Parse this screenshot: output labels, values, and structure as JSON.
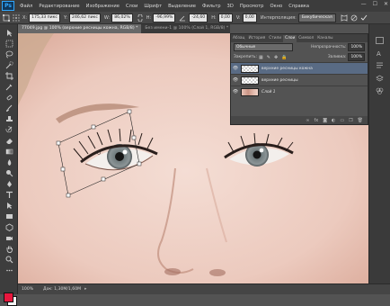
{
  "app": {
    "logo": "Ps",
    "menu": [
      "Файл",
      "Редактирование",
      "Изображение",
      "Слои",
      "Шрифт",
      "Выделение",
      "Фильтр",
      "3D",
      "Просмотр",
      "Окно",
      "Справка"
    ],
    "window_controls": [
      "—",
      "☐",
      "✕"
    ]
  },
  "options_bar": {
    "x_label": "X:",
    "x_value": "175,33 пикс",
    "y_label": "Y:",
    "y_value": "246,62 пикс",
    "w_label": "W:",
    "w_value": "86,02%",
    "h_label": "H:",
    "h_value": "-96,99%",
    "angle_value": "-24,60",
    "h_skew_label": "H:",
    "h_skew_value": "0,00",
    "v_skew_label": "V:",
    "v_skew_value": "0,00",
    "interp_label": "Интерполяция:",
    "interp_value": "Бикубическая"
  },
  "document": {
    "active_tab": "77049.jpg @ 100% (верхние ресницы кожна, RGB/8) *",
    "inactive_tab": "Без имени-1 @ 100% (Слой 1, RGB/8) *",
    "zoom": "100%",
    "doc_info": "Док: 1,30M/1,60M"
  },
  "layers_panel": {
    "tabs": [
      "Абзац",
      "История",
      "Стили",
      "Слои",
      "Символ",
      "Каналы"
    ],
    "active_tab": "Слои",
    "blend_mode": "Обычные",
    "opacity_label": "Непрозрачность:",
    "opacity_value": "100%",
    "lock_label": "Закрепить:",
    "fill_label": "Заливка:",
    "fill_value": "100%",
    "layers": [
      {
        "name": "верхние ресницы кожна",
        "selected": true
      },
      {
        "name": "верхние ресницы",
        "selected": false
      },
      {
        "name": "Слой 1",
        "selected": false
      }
    ],
    "footer_icons": [
      "link-icon",
      "fx-icon",
      "mask-icon",
      "adjustment-icon",
      "folder-icon",
      "new-layer-icon",
      "trash-icon"
    ]
  },
  "colors": {
    "foreground": "#e8173d",
    "background": "#f4f4f4",
    "selected_layer": "#596b84"
  }
}
